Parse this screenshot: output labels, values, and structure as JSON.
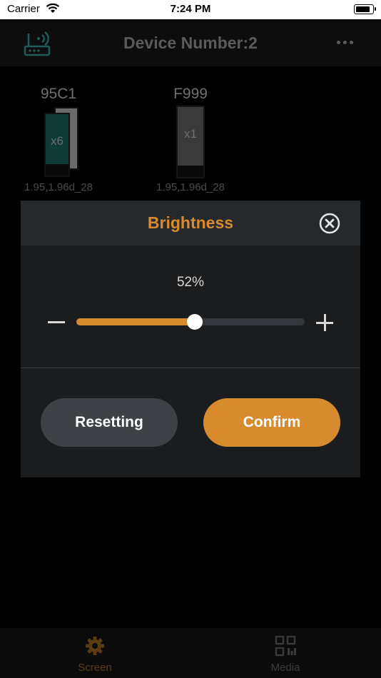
{
  "status_bar": {
    "carrier": "Carrier",
    "time": "7:24 PM"
  },
  "nav": {
    "title": "Device Number:2",
    "left_icon": "router-wifi-icon",
    "right_icon": "more-dots-icon"
  },
  "devices": [
    {
      "name": "95C1",
      "count_label": "x6",
      "version": "1.95,1.96d_28"
    },
    {
      "name": "F999",
      "count_label": "x1",
      "version": "1.95,1.96d_28"
    }
  ],
  "brightness_modal": {
    "title": "Brightness",
    "percent_text": "52%",
    "value": 0.52,
    "reset_label": "Resetting",
    "confirm_label": "Confirm"
  },
  "tabs": [
    {
      "label": "Screen",
      "icon": "gear-icon",
      "active": true
    },
    {
      "label": "Media",
      "icon": "qr-code-icon",
      "active": false
    }
  ],
  "colors": {
    "accent": "#d88b2e",
    "background": "#000000",
    "modal": "#1b1c1e"
  }
}
